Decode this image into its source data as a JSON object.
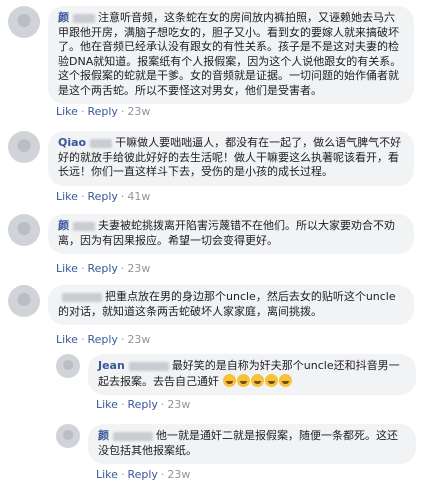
{
  "comments": [
    {
      "name": "颜",
      "text": "注意听音频，这条蛇在女的房间放内裤拍照，又诬赖她去马六甲跟他开房，满脑子想吃女的，胆子又小。看到女的要嫁人就来搞破坏了。他在音频已经承认没有跟女的有性关系。孩子是不是这对夫妻的检验DNA就知道。报案纸有个人报假案，因为这个人说他跟女的有关系。这个报假案的蛇就是干爹。女的音频就是证据。一切问题的始作俑者就是这个两舌蛇。所以不要怪这对男女，他们是受害者。",
      "like": "Like",
      "reply": "Reply",
      "time": "23w"
    },
    {
      "name": "Qiao",
      "text": "干嘛做人要咄咄逼人，都没有在一起了，做么语气脾气不好好的就放手给彼此好好的去生活呢！做人干嘛要这么执著呢该看开，看长远！你们一直这样斗下去，受伤的是小孩的成长过程。",
      "like": "Like",
      "reply": "Reply",
      "time": "41w"
    },
    {
      "name": "颜",
      "text": "夫妻被蛇挑拨离开陷害污蔑错不在他们。所以大家要劝合不劝离，因为有因果报应。希望一切会变得更好。",
      "like": "Like",
      "reply": "Reply",
      "time": "23w"
    },
    {
      "name": "",
      "text": "把重点放在男的身边那个uncle，然后去女的贴听这个uncle的对话，就知道这条两舌蛇破坏人家家庭，离间挑拨。",
      "like": "Like",
      "reply": "Reply",
      "time": "23w"
    }
  ],
  "replies": [
    {
      "name": "Jean",
      "text": "最好笑的是自称为奸夫那个uncle还和抖音男一起去报案。去告自己通奸",
      "emoji_count": 5,
      "like": "Like",
      "reply": "Reply",
      "time": "23w"
    },
    {
      "name": "颜",
      "text": "他一就是通奸二就是报假案，随便一条都死。这还没包括其他报案纸。",
      "like": "Like",
      "reply": "Reply",
      "time": "23w"
    }
  ],
  "colors": {
    "name": "#385898",
    "bubble": "#f2f3f5",
    "meta": "#90949c"
  }
}
